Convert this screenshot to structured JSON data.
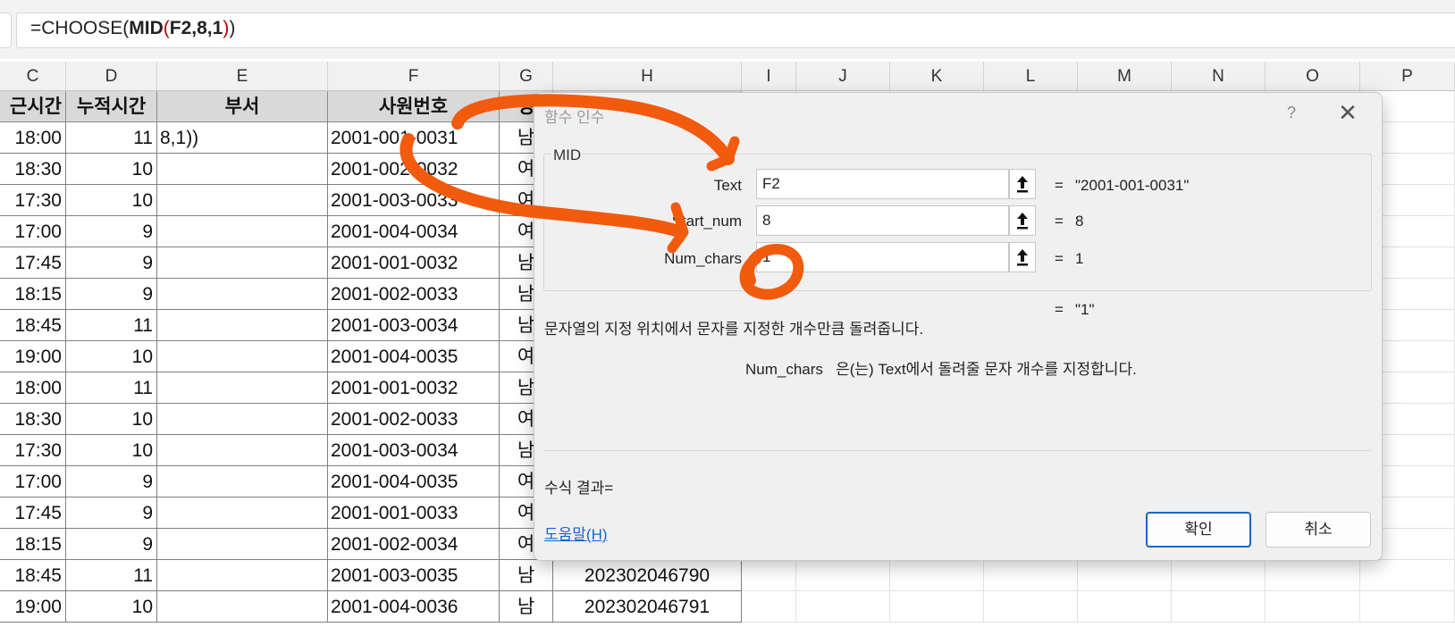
{
  "formula_bar": {
    "prefix": "=CHOOSE(",
    "fn": "MID",
    "open": "(",
    "args": "F2,8,1",
    "close": ")",
    "tail": ")"
  },
  "columns": [
    "C",
    "D",
    "E",
    "F",
    "G",
    "H",
    "I",
    "J",
    "K",
    "L",
    "M",
    "N",
    "O",
    "P"
  ],
  "header_row": [
    "근시간",
    "누적시간",
    "부서",
    "사원번호",
    "성",
    ""
  ],
  "rows": [
    {
      "c": "18:00",
      "d": "11",
      "e": "8,1))",
      "f": "2001-001-0031",
      "g": "남",
      "h": ""
    },
    {
      "c": "18:30",
      "d": "10",
      "e": "",
      "f": "2001-002-0032",
      "g": "여",
      "h": ""
    },
    {
      "c": "17:30",
      "d": "10",
      "e": "",
      "f": "2001-003-0033",
      "g": "여",
      "h": ""
    },
    {
      "c": "17:00",
      "d": "9",
      "e": "",
      "f": "2001-004-0034",
      "g": "여",
      "h": ""
    },
    {
      "c": "17:45",
      "d": "9",
      "e": "",
      "f": "2001-001-0032",
      "g": "남",
      "h": ""
    },
    {
      "c": "18:15",
      "d": "9",
      "e": "",
      "f": "2001-002-0033",
      "g": "남",
      "h": ""
    },
    {
      "c": "18:45",
      "d": "11",
      "e": "",
      "f": "2001-003-0034",
      "g": "남",
      "h": ""
    },
    {
      "c": "19:00",
      "d": "10",
      "e": "",
      "f": "2001-004-0035",
      "g": "여",
      "h": ""
    },
    {
      "c": "18:00",
      "d": "11",
      "e": "",
      "f": "2001-001-0032",
      "g": "남",
      "h": ""
    },
    {
      "c": "18:30",
      "d": "10",
      "e": "",
      "f": "2001-002-0033",
      "g": "여",
      "h": ""
    },
    {
      "c": "17:30",
      "d": "10",
      "e": "",
      "f": "2001-003-0034",
      "g": "남",
      "h": ""
    },
    {
      "c": "17:00",
      "d": "9",
      "e": "",
      "f": "2001-004-0035",
      "g": "여",
      "h": ""
    },
    {
      "c": "17:45",
      "d": "9",
      "e": "",
      "f": "2001-001-0033",
      "g": "여",
      "h": ""
    },
    {
      "c": "18:15",
      "d": "9",
      "e": "",
      "f": "2001-002-0034",
      "g": "여",
      "h": ""
    },
    {
      "c": "18:45",
      "d": "11",
      "e": "",
      "f": "2001-003-0035",
      "g": "남",
      "h": "202302046790"
    },
    {
      "c": "19:00",
      "d": "10",
      "e": "",
      "f": "2001-004-0036",
      "g": "남",
      "h": "202302046791"
    }
  ],
  "dialog": {
    "title": "함수 인수",
    "help_glyph": "?",
    "close_glyph": "✕",
    "function_name": "MID",
    "args": [
      {
        "label": "Text",
        "value": "F2",
        "eq": "=",
        "result": "\"2001-001-0031\""
      },
      {
        "label": "Start_num",
        "value": "8",
        "eq": "=",
        "result": "8"
      },
      {
        "label": "Num_chars",
        "value": "1",
        "eq": "=",
        "result": "1"
      }
    ],
    "overall_eq": "=",
    "overall_result": "\"1\"",
    "description": "문자열의 지정 위치에서 문자를 지정한 개수만큼 돌려줍니다.",
    "arg_description": "Num_chars   은(는) Text에서 돌려줄 문자 개수를 지정합니다.",
    "formula_result_label": "수식 결과=",
    "help_link": "도움말(H)",
    "ok_label": "확인",
    "cancel_label": "취소"
  },
  "colors": {
    "annotation": "#f25a0e",
    "accent": "#1a64c8",
    "header_fill": "#d9d9d9"
  }
}
